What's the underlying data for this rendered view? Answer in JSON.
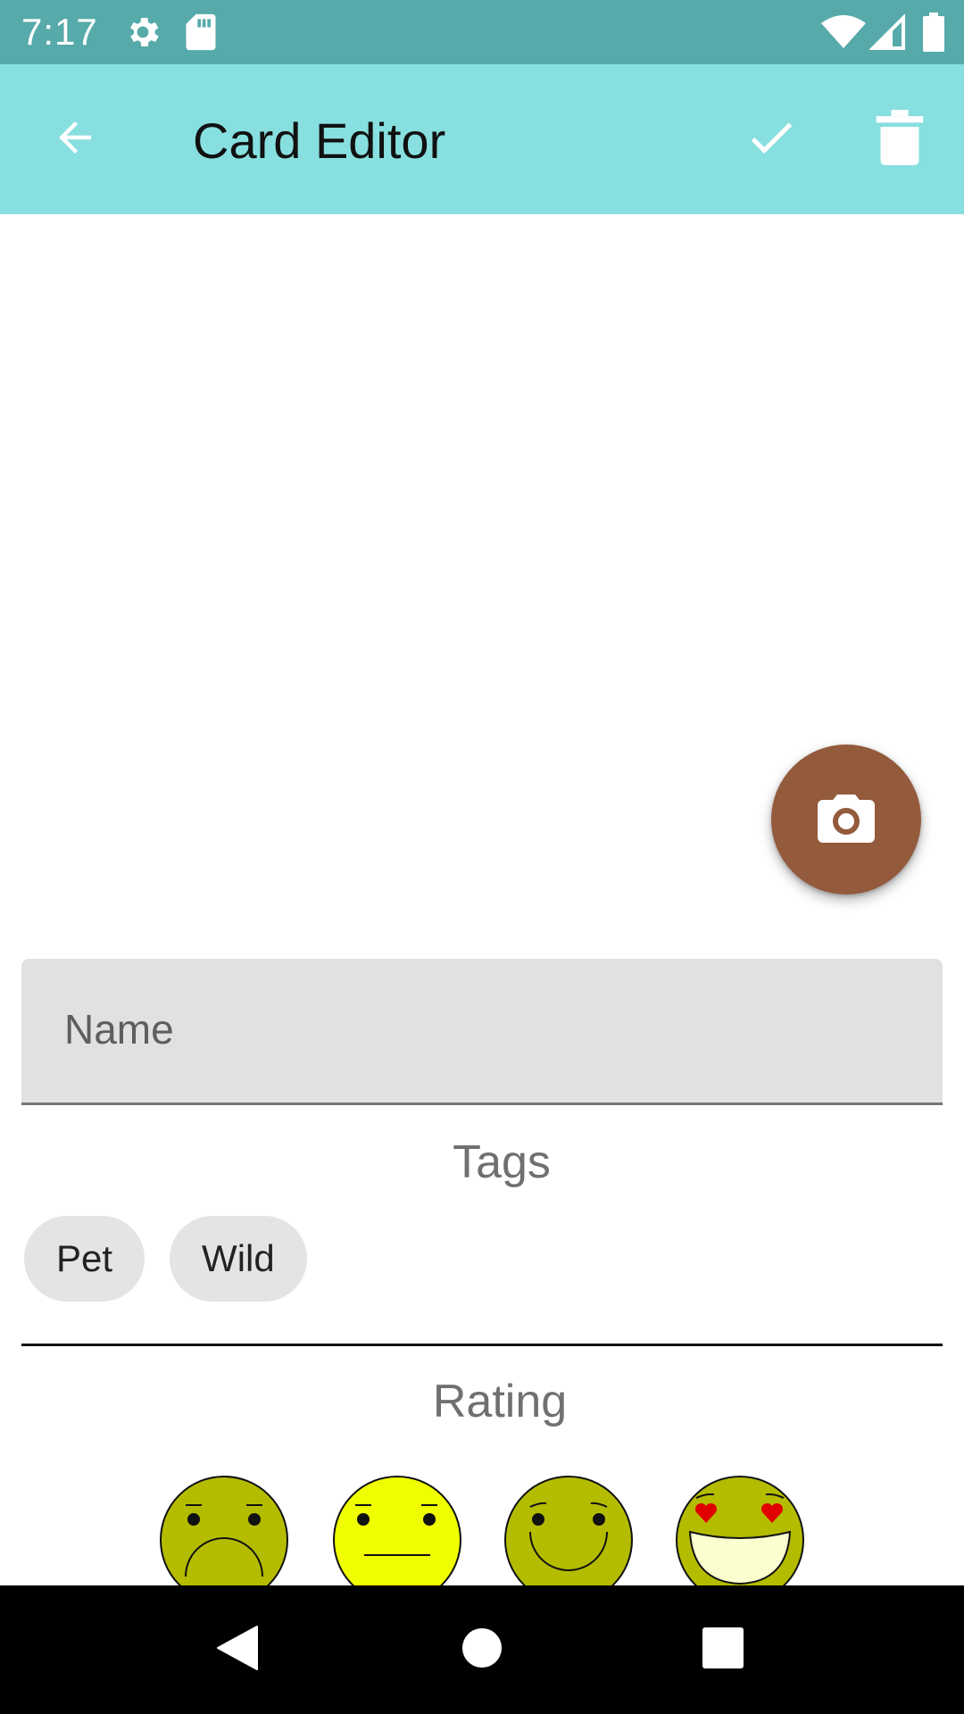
{
  "status_bar": {
    "time": "7:17",
    "left_icons": [
      "gear-icon",
      "sd-card-icon"
    ],
    "right_icons": [
      "wifi-icon",
      "cell-signal-icon",
      "battery-icon"
    ]
  },
  "app_bar": {
    "title": "Card Editor",
    "back_icon": "arrow-left-icon",
    "save_icon": "check-icon",
    "delete_icon": "trash-icon",
    "background": "#88dfdf"
  },
  "fab": {
    "icon": "camera-icon",
    "color": "#935a3c"
  },
  "name_field": {
    "placeholder": "Name",
    "value": ""
  },
  "tags": {
    "heading": "Tags",
    "chips": [
      "Pet",
      "Wild"
    ]
  },
  "rating": {
    "heading": "Rating",
    "faces": [
      "sad-face",
      "neutral-face",
      "smile-face",
      "love-face"
    ]
  },
  "nav_bar": {
    "icons": [
      "back-triangle-icon",
      "home-circle-icon",
      "recents-square-icon"
    ]
  },
  "colors": {
    "status_bar": "#56aaaa",
    "app_bar": "#88dfdf",
    "fab": "#935a3c",
    "face_olive": "#b4bc00",
    "face_yellow": "#f0ff00"
  }
}
